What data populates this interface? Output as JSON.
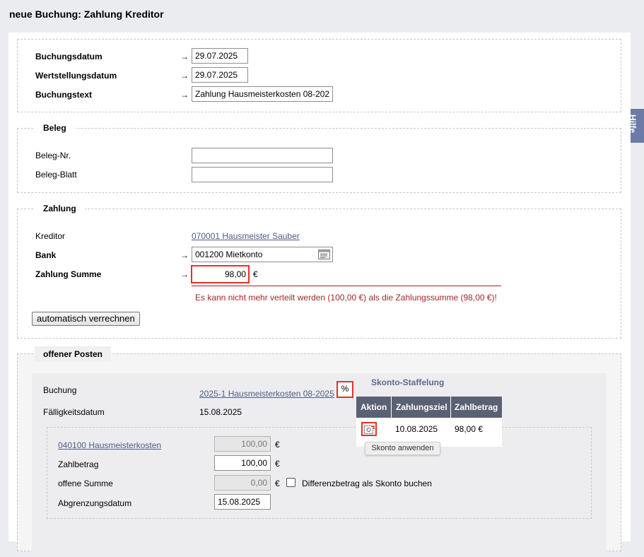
{
  "page_title": "neue Buchung: Zahlung Kreditor",
  "help_tab": "Hilfe",
  "arrow_glyph": "→",
  "booking": {
    "date_label": "Buchungsdatum",
    "date_value": "29.07.2025",
    "value_date_label": "Wertstellungsdatum",
    "value_date_value": "29.07.2025",
    "text_label": "Buchungstext",
    "text_value": "Zahlung Hausmeisterkosten 08-202"
  },
  "beleg": {
    "legend": "Beleg",
    "nr_label": "Beleg-Nr.",
    "nr_value": "",
    "blatt_label": "Beleg-Blatt",
    "blatt_value": ""
  },
  "zahlung": {
    "legend": "Zahlung",
    "kreditor_label": "Kreditor",
    "kreditor_value": "070001 Hausmeister Sauber",
    "bank_label": "Bank",
    "bank_value": "001200 Mietkonto",
    "sum_label": "Zahlung Summe",
    "sum_value": "98,00",
    "currency": "€",
    "error_text": "Es kann nicht mehr verteilt werden (100,00 €) als die Zahlungssumme (98,00 €)!",
    "auto_button": "automatisch verrechnen"
  },
  "offene_posten": {
    "legend": "offener Posten",
    "buchung_label": "Buchung",
    "buchung_value": "2025-1 Hausmeisterkosten 08-2025",
    "percent_button": "%",
    "faellig_label": "Fälligkeitsdatum",
    "faellig_value": "15.08.2025",
    "account_link": "040100 Hausmeisterkosten",
    "account_value": "100,00",
    "zahlbetrag_label": "Zahlbetrag",
    "zahlbetrag_value": "100,00",
    "offene_label": "offene Summe",
    "offene_value": "0,00",
    "diff_checkbox_label": "Differenzbetrag als Skonto buchen",
    "abgrenzung_label": "Abgrenzungsdatum",
    "abgrenzung_value": "15.08.2025",
    "currency": "€"
  },
  "skonto": {
    "title": "Skonto-Staffelung",
    "headers": [
      "Aktion",
      "Zahlungsziel",
      "Zahlbetrag"
    ],
    "row": {
      "zahlungsziel": "10.08.2025",
      "zahlbetrag": "98,00 €"
    },
    "tooltip": "Skonto anwenden"
  }
}
